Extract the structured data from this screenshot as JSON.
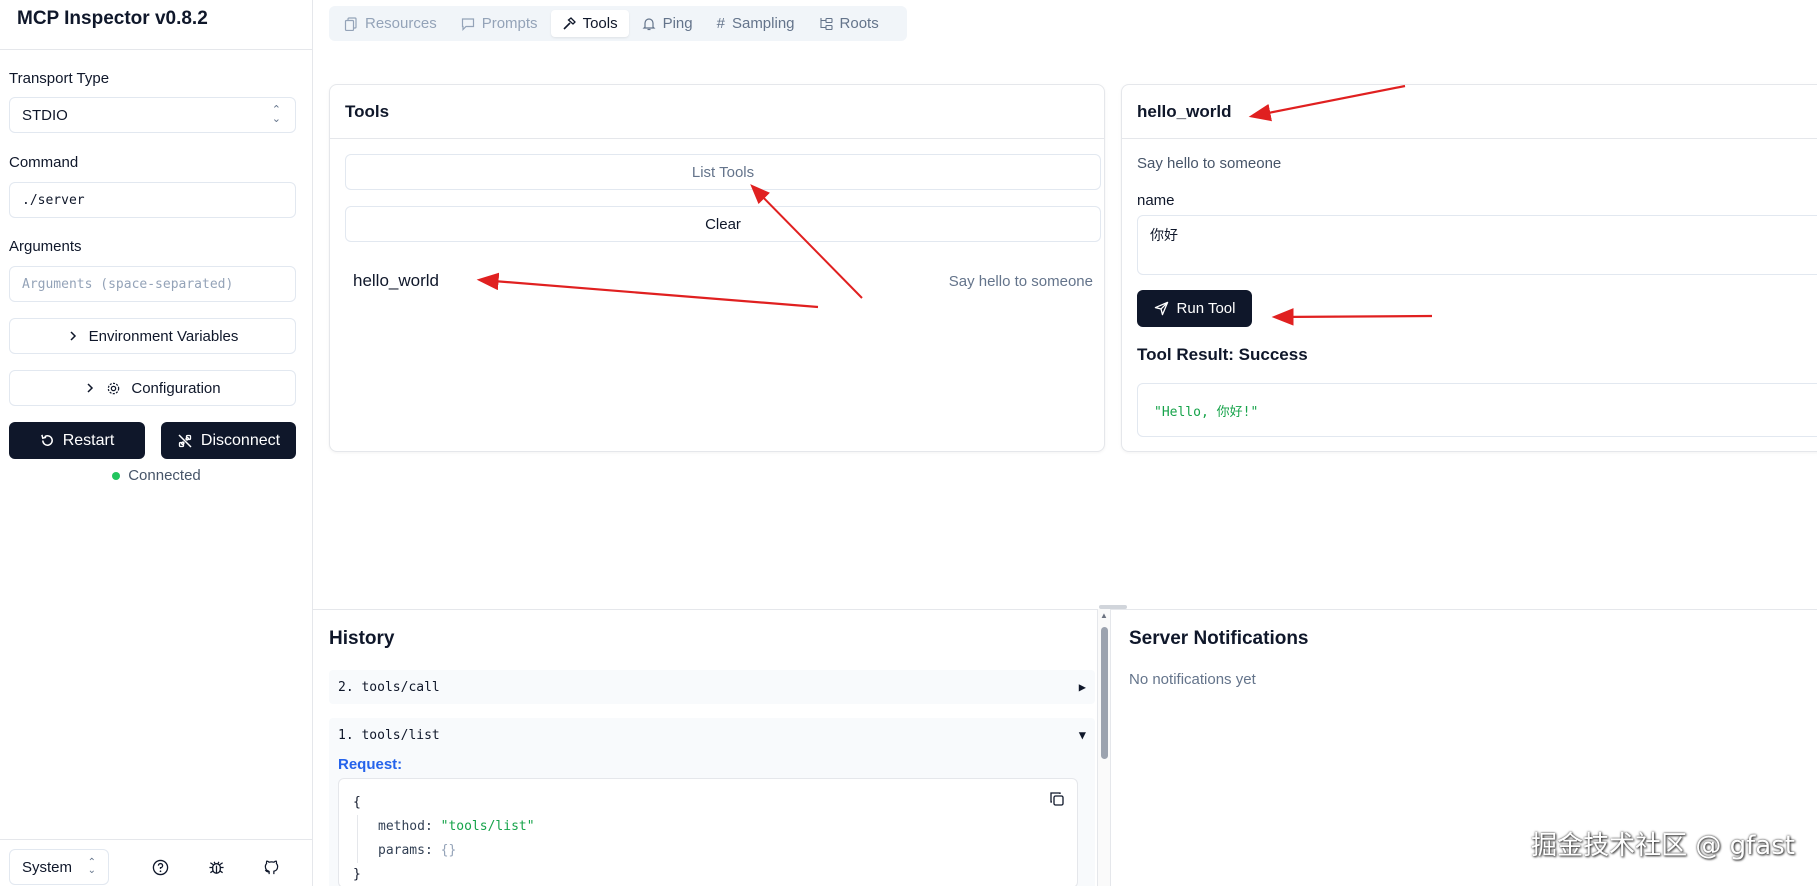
{
  "sidebar": {
    "app_title": "MCP Inspector v0.8.2",
    "transport_label": "Transport Type",
    "transport_value": "STDIO",
    "command_label": "Command",
    "command_value": "./server",
    "arguments_label": "Arguments",
    "arguments_placeholder": "Arguments (space-separated)",
    "env_label": "Environment Variables",
    "config_label": "Configuration",
    "restart_label": "Restart",
    "disconnect_label": "Disconnect",
    "status_text": "Connected",
    "theme_value": "System"
  },
  "tabs": [
    {
      "label": "Resources",
      "icon": "files-icon"
    },
    {
      "label": "Prompts",
      "icon": "message-icon"
    },
    {
      "label": "Tools",
      "icon": "hammer-icon"
    },
    {
      "label": "Ping",
      "icon": "bell-icon"
    },
    {
      "label": "Sampling",
      "icon": "hash-icon"
    },
    {
      "label": "Roots",
      "icon": "folder-tree-icon"
    }
  ],
  "tools_panel": {
    "title": "Tools",
    "list_button": "List Tools",
    "clear_button": "Clear",
    "items": [
      {
        "name": "hello_world",
        "description": "Say hello to someone"
      }
    ]
  },
  "tool_detail": {
    "title": "hello_world",
    "description": "Say hello to someone",
    "param_label": "name",
    "param_value": "你好",
    "run_button": "Run Tool",
    "result_title": "Tool Result: Success",
    "result_value": "\"Hello, 你好!\""
  },
  "history": {
    "title": "History",
    "items": [
      {
        "label": "2. tools/call",
        "toggle": "▶"
      },
      {
        "label": "1. tools/list",
        "toggle": "▼"
      }
    ],
    "request_label": "Request:",
    "code": {
      "open": "{",
      "method_key": "method:",
      "method_value": "\"tools/list\"",
      "params_key": "params:",
      "params_value": "{}",
      "close": "}"
    }
  },
  "notifications": {
    "title": "Server Notifications",
    "empty_text": "No notifications yet"
  },
  "watermark": "掘金技术社区 @ gfast",
  "colors": {
    "primary": "#0f172a",
    "success": "#22c55e",
    "link": "#2563eb",
    "arrow": "#e02020"
  }
}
